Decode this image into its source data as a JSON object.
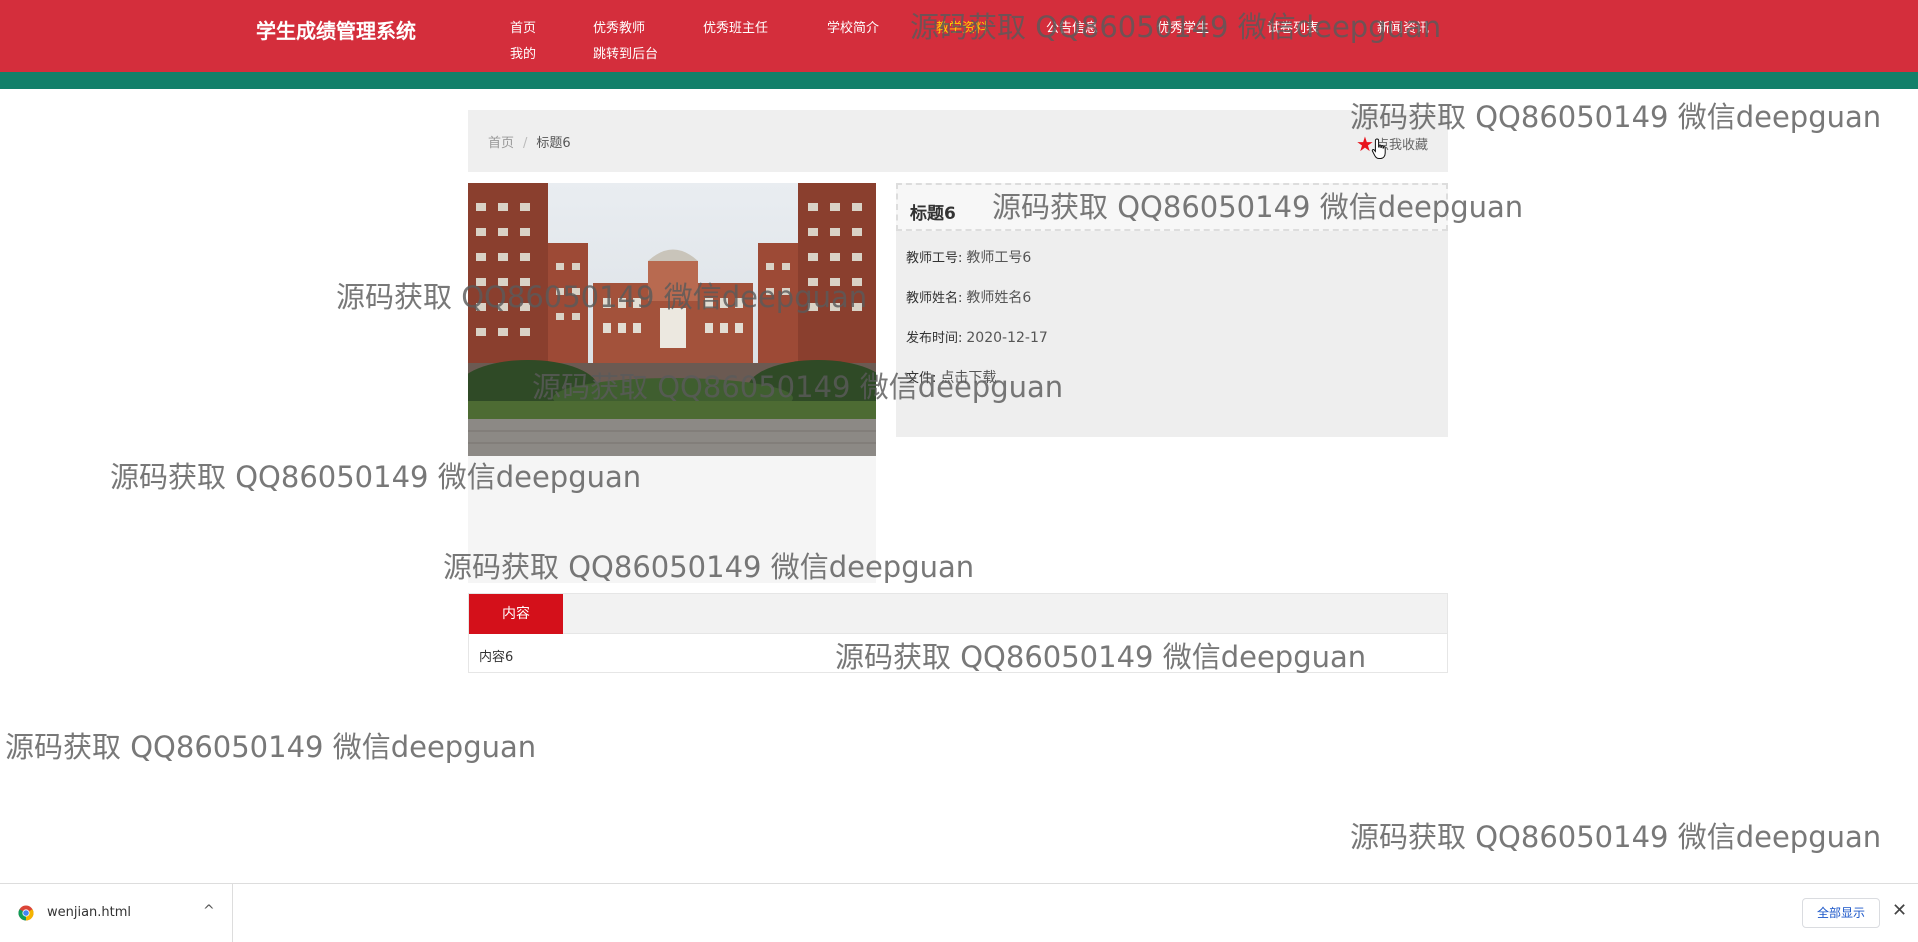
{
  "header": {
    "site_title": "学生成绩管理系统",
    "nav": [
      "首页",
      "优秀教师",
      "优秀班主任",
      "学校简介",
      "教学资料",
      "公告信息",
      "优秀学生",
      "试卷列表",
      "新闻资讯",
      "我的",
      "跳转到后台"
    ],
    "active_nav": "教学资料",
    "colors": {
      "header_red": "#d42e3c",
      "strip_green": "#12806a",
      "active_yellow": "#ffd200"
    }
  },
  "breadcrumb": {
    "home": "首页",
    "separator": "/",
    "current": "标题6"
  },
  "favorite": {
    "label": "点我收藏",
    "icon": "star-icon"
  },
  "photo": {
    "alt": "school-building-photo"
  },
  "detail": {
    "title": "标题6",
    "rows": [
      {
        "label": "教师工号:",
        "value": "教师工号6"
      },
      {
        "label": "教师姓名:",
        "value": "教师姓名6"
      },
      {
        "label": "发布时间:",
        "value": "2020-12-17"
      },
      {
        "label": "文件:",
        "value": "点击下载"
      }
    ]
  },
  "tabs": {
    "active_label": "内容",
    "content": "内容6",
    "active_color": "#d4101a"
  },
  "watermark": "源码获取 QQ86050149 微信deepguan",
  "download_bar": {
    "file_name": "wenjian.html",
    "chevron": "^",
    "show_all": "全部显示",
    "close": "✕"
  }
}
